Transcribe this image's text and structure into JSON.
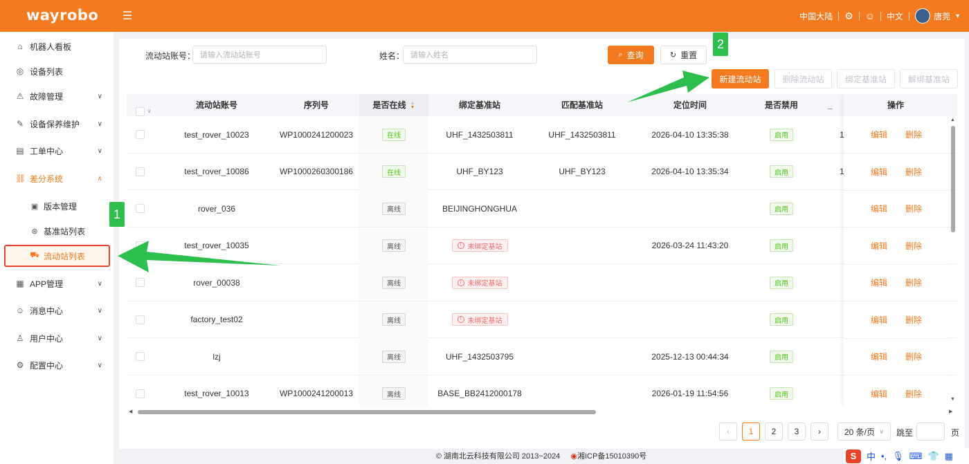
{
  "header": {
    "logo": "wayrobo",
    "region": "中国大陆",
    "language": "中文",
    "username": "唐莞"
  },
  "sidebar": {
    "items": [
      {
        "label": "机器人看板",
        "icon": "home-icon"
      },
      {
        "label": "设备列表",
        "icon": "watch-icon"
      },
      {
        "label": "故障管理",
        "icon": "warning-icon"
      },
      {
        "label": "设备保养维护",
        "icon": "wrench-icon"
      },
      {
        "label": "工单中心",
        "icon": "document-icon"
      },
      {
        "label": "差分系统",
        "icon": "network-icon"
      },
      {
        "label": "APP管理",
        "icon": "grid-icon"
      },
      {
        "label": "消息中心",
        "icon": "message-icon"
      },
      {
        "label": "用户中心",
        "icon": "user-icon"
      },
      {
        "label": "配置中心",
        "icon": "gear-icon"
      }
    ],
    "sub_items": [
      {
        "label": "版本管理"
      },
      {
        "label": "基准站列表"
      },
      {
        "label": "流动站列表"
      }
    ]
  },
  "filters": {
    "account_label": "流动站账号：",
    "account_placeholder": "请输入流动站账号",
    "name_label": "姓名：",
    "name_placeholder": "请输入姓名",
    "query": "查询",
    "reset": "重置"
  },
  "actions": {
    "new": "新建流动站",
    "delete": "删除流动站",
    "bind": "绑定基准站",
    "unbind": "解绑基准站"
  },
  "table": {
    "headers": [
      "流动站账号",
      "序列号",
      "是否在线",
      "绑定基准站",
      "匹配基准站",
      "定位时间",
      "是否禁用",
      "操作"
    ],
    "edit": "编辑",
    "remove": "删除",
    "unbound_text": "未绑定基站",
    "rows": [
      {
        "account": "test_rover_10023",
        "serial": "WP1000241200023",
        "online": "在线",
        "bind": "UHF_1432503811",
        "match": "UHF_1432503811",
        "time": "2026-04-10 13:35:38",
        "disabled": "启用",
        "extra": "1"
      },
      {
        "account": "test_rover_10086",
        "serial": "WP1000260300186",
        "online": "在线",
        "bind": "UHF_BY123",
        "match": "UHF_BY123",
        "time": "2026-04-10 13:35:34",
        "disabled": "启用",
        "extra": "1"
      },
      {
        "account": "rover_036",
        "serial": "",
        "online": "离线",
        "bind": "BEIJINGHONGHUA",
        "match": "",
        "time": "",
        "disabled": "启用",
        "extra": ""
      },
      {
        "account": "test_rover_10035",
        "serial": "",
        "online": "离线",
        "bind": "__unbound__",
        "match": "",
        "time": "2026-03-24 11:43:20",
        "disabled": "启用",
        "extra": ""
      },
      {
        "account": "rover_00038",
        "serial": "",
        "online": "离线",
        "bind": "__unbound__",
        "match": "",
        "time": "",
        "disabled": "启用",
        "extra": ""
      },
      {
        "account": "factory_test02",
        "serial": "",
        "online": "离线",
        "bind": "__unbound__",
        "match": "",
        "time": "",
        "disabled": "启用",
        "extra": ""
      },
      {
        "account": "lzj",
        "serial": "",
        "online": "离线",
        "bind": "UHF_1432503795",
        "match": "",
        "time": "2025-12-13 00:44:34",
        "disabled": "启用",
        "extra": ""
      },
      {
        "account": "test_rover_10013",
        "serial": "WP1000241200013",
        "online": "离线",
        "bind": "BASE_BB2412000178",
        "match": "",
        "time": "2026-01-19 11:54:56",
        "disabled": "启用",
        "extra": ""
      }
    ]
  },
  "pagination": {
    "pages": [
      "1",
      "2",
      "3"
    ],
    "current": "1",
    "page_size": "20 条/页",
    "goto_label": "跳至",
    "page_unit": "页"
  },
  "footer": {
    "copyright": "© 湖南北云科技有限公司 2013~2024",
    "icp": "湘ICP备15010390号"
  },
  "annotations": {
    "badge1": "1",
    "badge2": "2"
  },
  "ime": {
    "logo": "S",
    "lang": "中"
  }
}
